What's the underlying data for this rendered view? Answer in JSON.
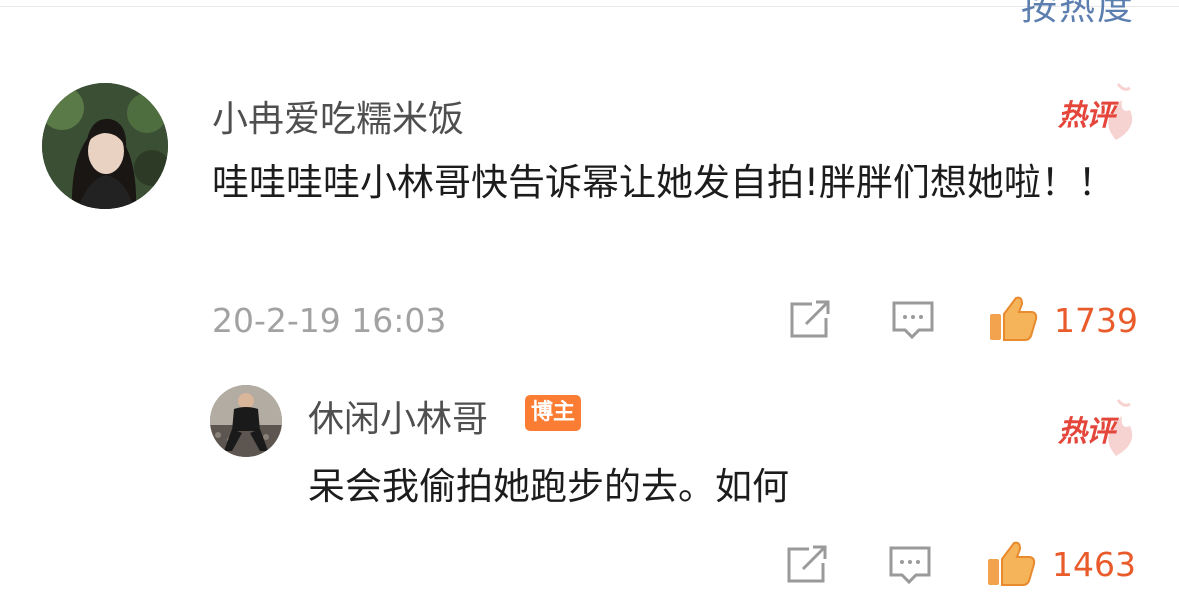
{
  "header": {
    "sort_label": "按热度"
  },
  "comment": {
    "username": "小冉爱吃糯米饭",
    "hot_label": "热评",
    "text": "哇哇哇哇小林哥快告诉幂让她发自拍!胖胖们想她啦！！",
    "timestamp": "20-2-19 16:03",
    "likes": "1739"
  },
  "reply": {
    "username": "休闲小林哥",
    "badge": "博主",
    "hot_label": "热评",
    "text": "呆会我偷拍她跑步的去。如何",
    "likes": "1463"
  },
  "icons": {
    "share": "share-icon",
    "comment": "comment-icon",
    "like": "thumbs-up-icon",
    "hot": "hot-comment-badge"
  },
  "colors": {
    "like_orange": "#e95b2b",
    "hot_red": "#e5463b",
    "badge_orange": "#fb7d34",
    "link_blue": "#5d7fb0"
  }
}
